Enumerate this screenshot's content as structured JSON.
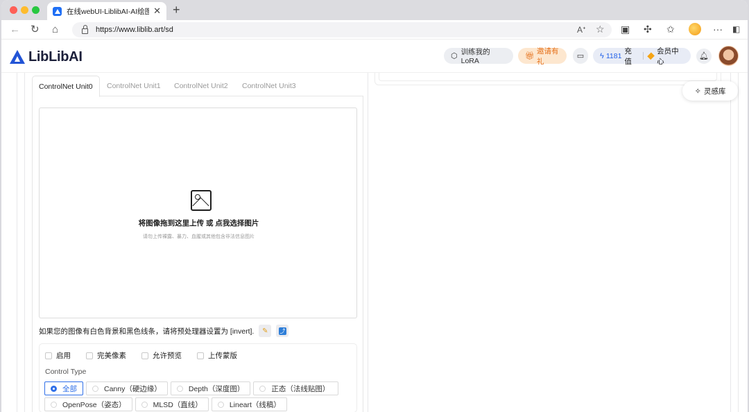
{
  "browser": {
    "tab_title": "在线webUI-LiblibAI-AI绘图工具",
    "tab_close": "✕",
    "new_tab": "+",
    "url": "https://www.liblib.art/sd",
    "icons": [
      "back-icon",
      "reload-icon",
      "home-icon",
      "lock-icon",
      "read-aloud-icon",
      "favorite-star-icon",
      "extension-icon",
      "puzzle-icon",
      "favorites-icon",
      "profile-icon",
      "more-icon",
      "sidebar-icon"
    ]
  },
  "header": {
    "logo_text": "LibLibAI",
    "train_lora": "训练我的LoRA",
    "invite": "邀请有礼",
    "credits": "1181",
    "recharge": "充值",
    "membership": "会员中心"
  },
  "inspiration": {
    "label": "灵感库"
  },
  "controlnet": {
    "tabs": [
      "ControlNet Unit0",
      "ControlNet Unit1",
      "ControlNet Unit2",
      "ControlNet Unit3"
    ],
    "active_tab": 0,
    "dropzone_main": "将图像拖到这里上传 或 点我选择图片",
    "dropzone_sub": "请勿上传裸露、暴力、血腥或其他包含非法信息图片",
    "hint": "如果您的图像有白色背景和黑色线条，请将预处理器设置为 [invert].",
    "checkboxes": [
      "启用",
      "完美像素",
      "允许预览",
      "上传蒙版"
    ],
    "control_type_label": "Control Type",
    "control_types": [
      "全部",
      "Canny（硬边缘）",
      "Depth（深度图）",
      "正态（法线贴图）",
      "OpenPose（姿态）",
      "MLSD（直线）",
      "Lineart（线稿）"
    ],
    "selected_control_type": "全部"
  },
  "colors": {
    "accent": "#2f6fe8",
    "brand": "#2254d6",
    "invite_bg": "#fde7cf",
    "invite_text": "#e5701a"
  }
}
